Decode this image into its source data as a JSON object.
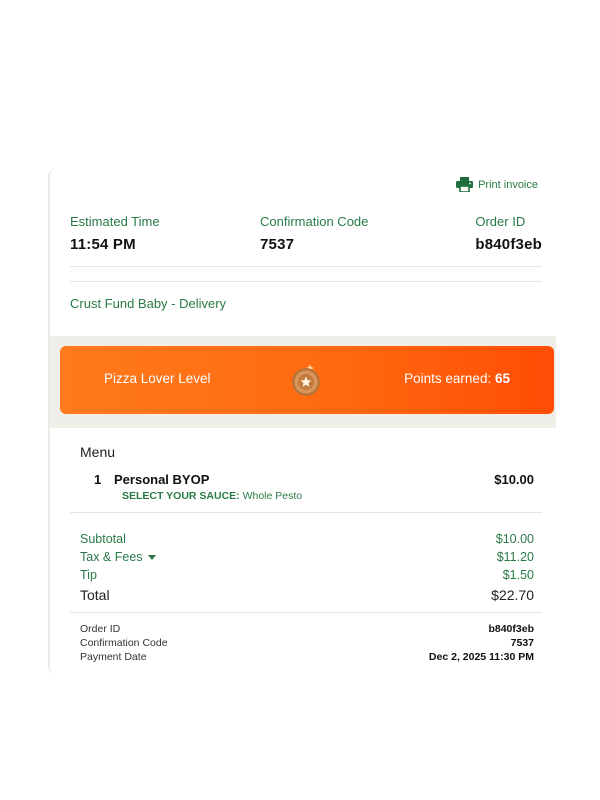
{
  "header": {
    "print_label": "Print invoice",
    "print_icon": "printer-icon"
  },
  "summary": {
    "estimated_time_label": "Estimated Time",
    "estimated_time_value": "11:54 PM",
    "confirmation_label": "Confirmation Code",
    "confirmation_value": "7537",
    "order_id_label": "Order ID",
    "order_id_value": "b840f3eb"
  },
  "store": {
    "name": "Crust Fund Baby - Delivery"
  },
  "rewards": {
    "level_label": "Pizza Lover Level",
    "points_label": "Points earned:",
    "points_value": "65",
    "medal_icon": "star-medal-icon"
  },
  "menu": {
    "title": "Menu",
    "items": [
      {
        "qty": "1",
        "name": "Personal BYOP",
        "price": "$10.00",
        "option_key": "SELECT YOUR SAUCE:",
        "option_value": "Whole Pesto"
      }
    ]
  },
  "totals": {
    "subtotal_label": "Subtotal",
    "subtotal_value": "$10.00",
    "tax_label": "Tax & Fees",
    "tax_value": "$11.20",
    "tip_label": "Tip",
    "tip_value": "$1.50",
    "total_label": "Total",
    "total_value": "$22.70"
  },
  "meta": {
    "order_id_label": "Order ID",
    "order_id_value": "b840f3eb",
    "confirmation_label": "Confirmation Code",
    "confirmation_value": "7537",
    "payment_date_label": "Payment Date",
    "payment_date_value": "Dec 2, 2025 11:30 PM"
  },
  "colors": {
    "green": "#2a7a48",
    "orange_start": "#ff7a1c",
    "orange_end": "#ff4d05",
    "band_bg": "#efeee8"
  }
}
